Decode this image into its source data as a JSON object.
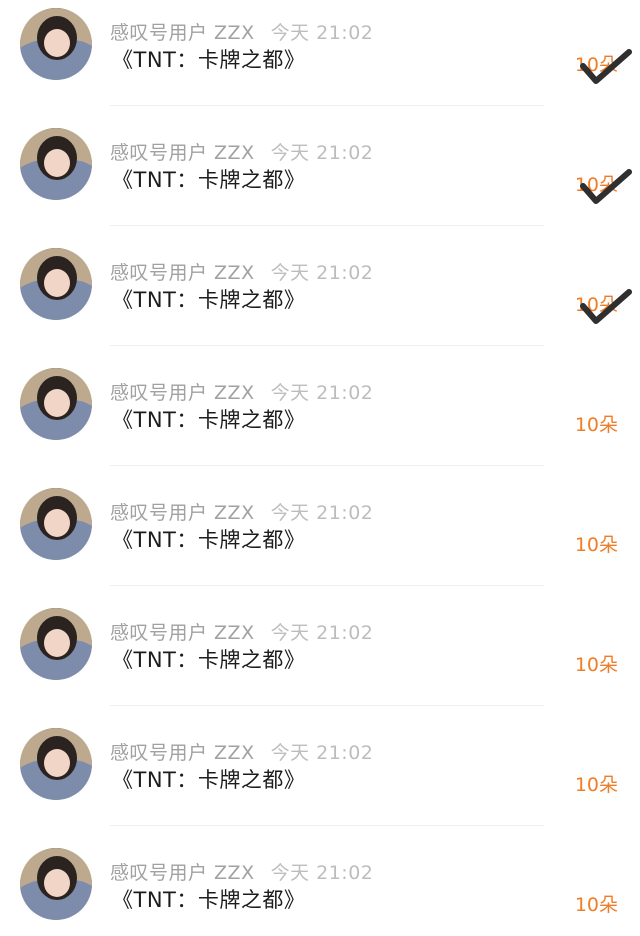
{
  "items": [
    {
      "user": "感叹号用户 ZZX",
      "time": "今天 21:02",
      "title": "《TNT：卡牌之都》",
      "count": "10朵",
      "checked": true
    },
    {
      "user": "感叹号用户 ZZX",
      "time": "今天 21:02",
      "title": "《TNT：卡牌之都》",
      "count": "10朵",
      "checked": true
    },
    {
      "user": "感叹号用户 ZZX",
      "time": "今天 21:02",
      "title": "《TNT：卡牌之都》",
      "count": "10朵",
      "checked": true
    },
    {
      "user": "感叹号用户 ZZX",
      "time": "今天 21:02",
      "title": "《TNT：卡牌之都》",
      "count": "10朵",
      "checked": false
    },
    {
      "user": "感叹号用户 ZZX",
      "time": "今天 21:02",
      "title": "《TNT：卡牌之都》",
      "count": "10朵",
      "checked": false
    },
    {
      "user": "感叹号用户 ZZX",
      "time": "今天 21:02",
      "title": "《TNT：卡牌之都》",
      "count": "10朵",
      "checked": false
    },
    {
      "user": "感叹号用户 ZZX",
      "time": "今天 21:02",
      "title": "《TNT：卡牌之都》",
      "count": "10朵",
      "checked": false
    },
    {
      "user": "感叹号用户 ZZX",
      "time": "今天 21:02",
      "title": "《TNT：卡牌之都》",
      "count": "10朵",
      "checked": false
    }
  ],
  "colors": {
    "accent": "#ef7d27",
    "name": "#a1a1a1",
    "time": "#bdbdbd",
    "title": "#1c1c1c",
    "divider": "#eeeeee"
  }
}
